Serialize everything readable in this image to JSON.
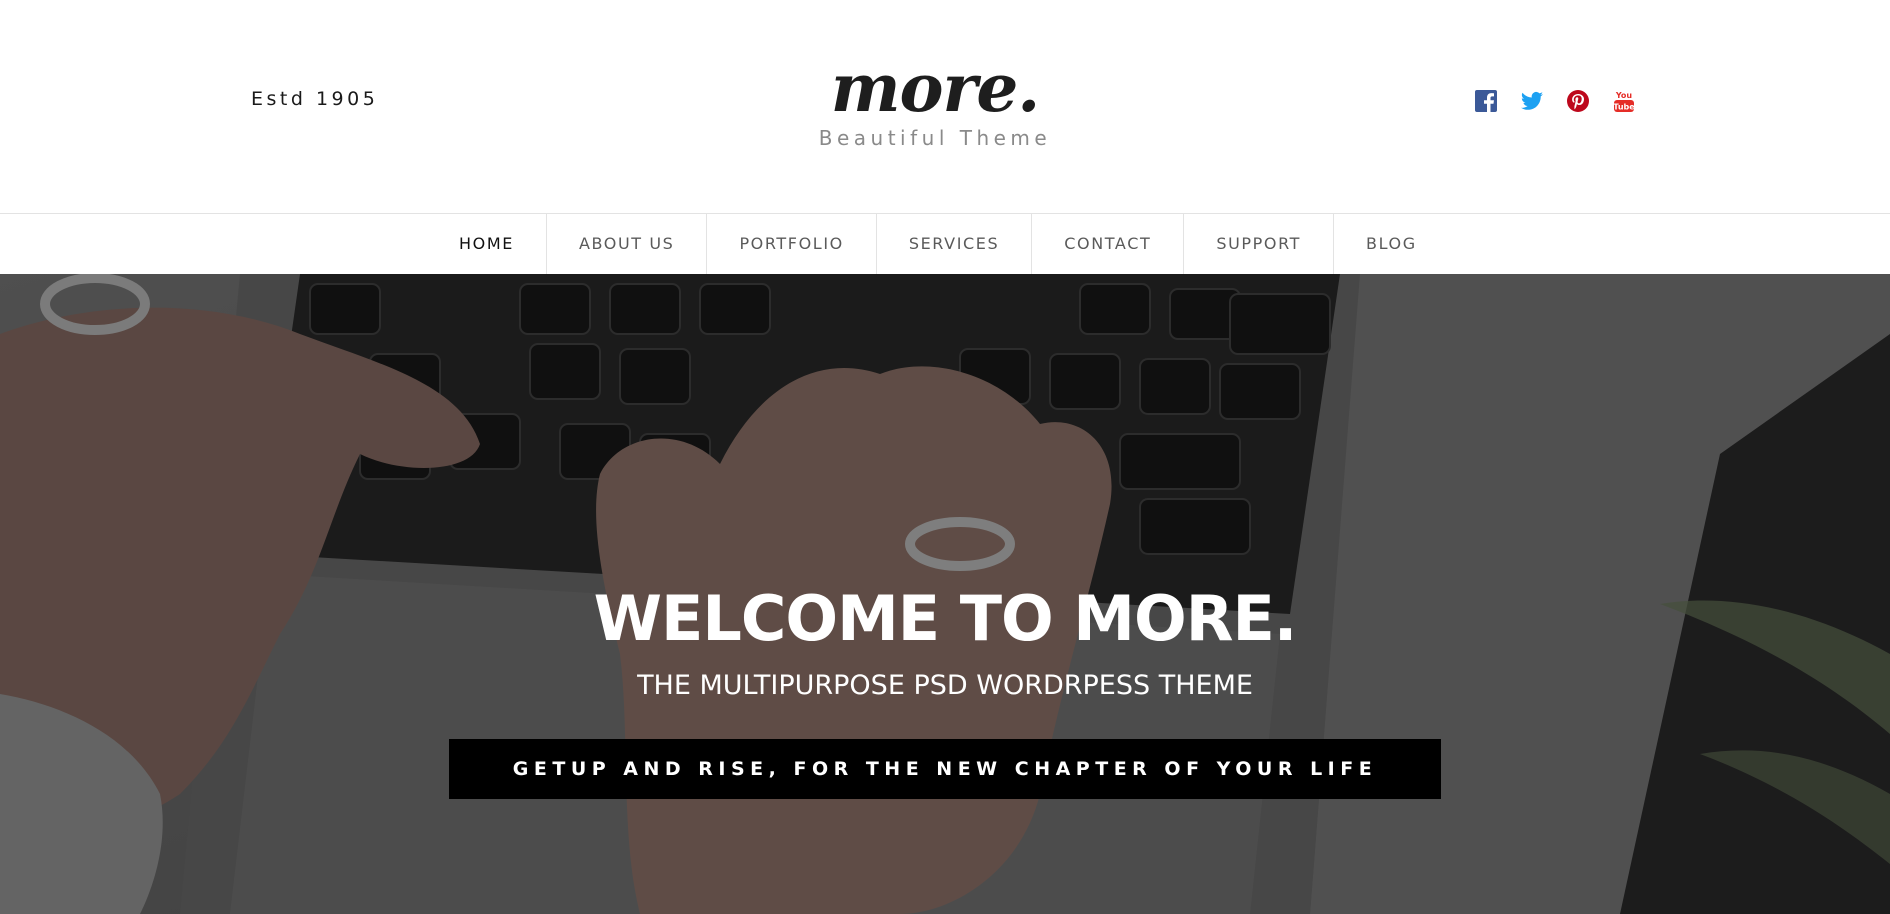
{
  "header": {
    "estd": "Estd 1905",
    "logo_word": "more.",
    "logo_tagline": "Beautiful Theme",
    "social": [
      {
        "icon": "facebook-icon",
        "color": "#3b5998"
      },
      {
        "icon": "twitter-icon",
        "color": "#1da1f2"
      },
      {
        "icon": "pinterest-icon",
        "color": "#bd081c"
      },
      {
        "icon": "youtube-icon",
        "color": "#e52d27"
      }
    ]
  },
  "nav": {
    "items": [
      {
        "label": "HOME",
        "active": true
      },
      {
        "label": "ABOUT US",
        "active": false
      },
      {
        "label": "PORTFOLIO",
        "active": false
      },
      {
        "label": "SERVICES",
        "active": false
      },
      {
        "label": "CONTACT",
        "active": false
      },
      {
        "label": "SUPPORT",
        "active": false
      },
      {
        "label": "BLOG",
        "active": false
      }
    ]
  },
  "hero": {
    "title": "WELCOME TO MORE.",
    "subtitle": "THE MULTIPURPOSE PSD WORDRPESS THEME",
    "banner": "GETUP AND RISE, FOR THE NEW CHAPTER OF YOUR LIFE"
  }
}
